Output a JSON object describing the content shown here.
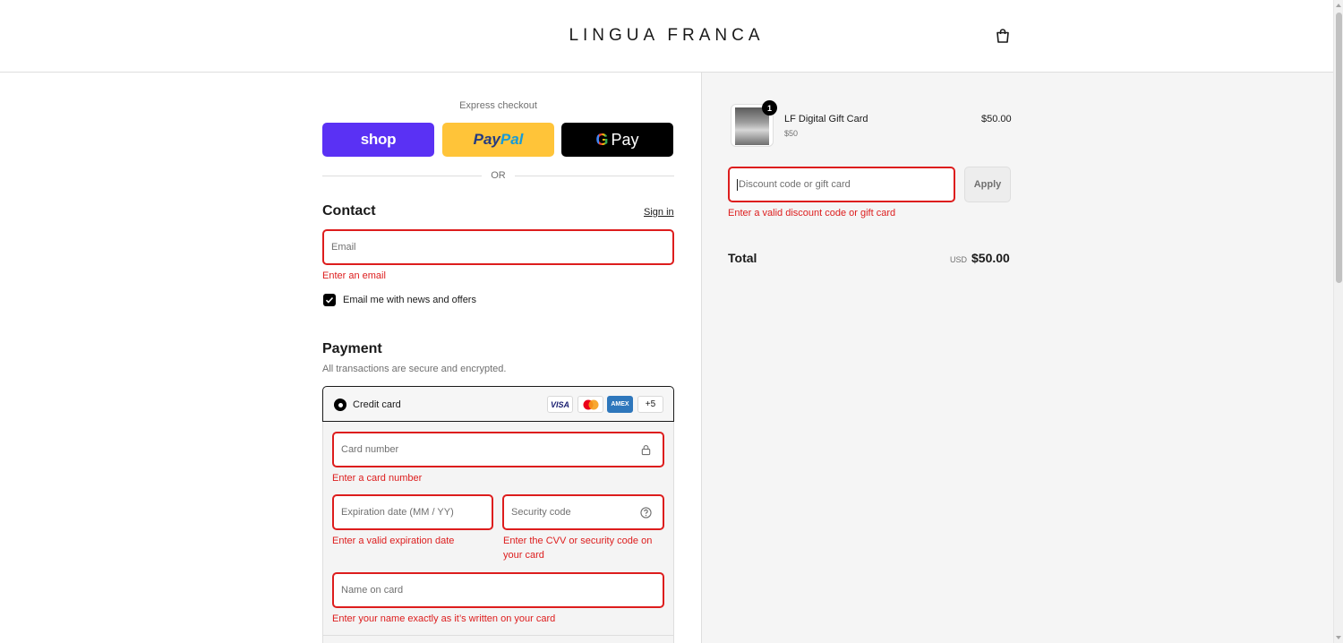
{
  "header": {
    "brand": "LINGUA FRANCA",
    "cart_icon": "shopping-bag-icon"
  },
  "express": {
    "title": "Express checkout",
    "shop_label": "shop",
    "paypal_label_1": "Pay",
    "paypal_label_2": "Pal",
    "gpay_g": "G",
    "gpay_label": "Pay",
    "or_label": "OR"
  },
  "contact": {
    "title": "Contact",
    "signin_label": "Sign in",
    "email_placeholder": "Email",
    "email_error": "Enter an email",
    "newsletter_label": "Email me with news and offers",
    "newsletter_checked": true
  },
  "payment": {
    "title": "Payment",
    "subtitle": "All transactions are secure and encrypted.",
    "method_label": "Credit card",
    "brands": {
      "visa": "VISA",
      "amex": "AMEX",
      "more": "+5"
    },
    "card_number_placeholder": "Card number",
    "card_number_error": "Enter a card number",
    "expiry_placeholder": "Expiration date (MM / YY)",
    "expiry_error": "Enter a valid expiration date",
    "cvv_placeholder": "Security code",
    "cvv_error": "Enter the CVV or security code on your card",
    "name_placeholder": "Name on card",
    "name_error": "Enter your name exactly as it’s written on your card"
  },
  "summary": {
    "item_qty": "1",
    "item_name": "LF Digital Gift Card",
    "item_variant": "$50",
    "item_price": "$50.00",
    "discount_placeholder": "Discount code or gift card",
    "apply_label": "Apply",
    "discount_error": "Enter a valid discount code or gift card",
    "total_label": "Total",
    "currency": "USD",
    "total_value": "$50.00"
  },
  "colors": {
    "error": "#dd1d1d",
    "shop": "#5a31f4",
    "paypal": "#ffc439",
    "gpay": "#000000"
  }
}
